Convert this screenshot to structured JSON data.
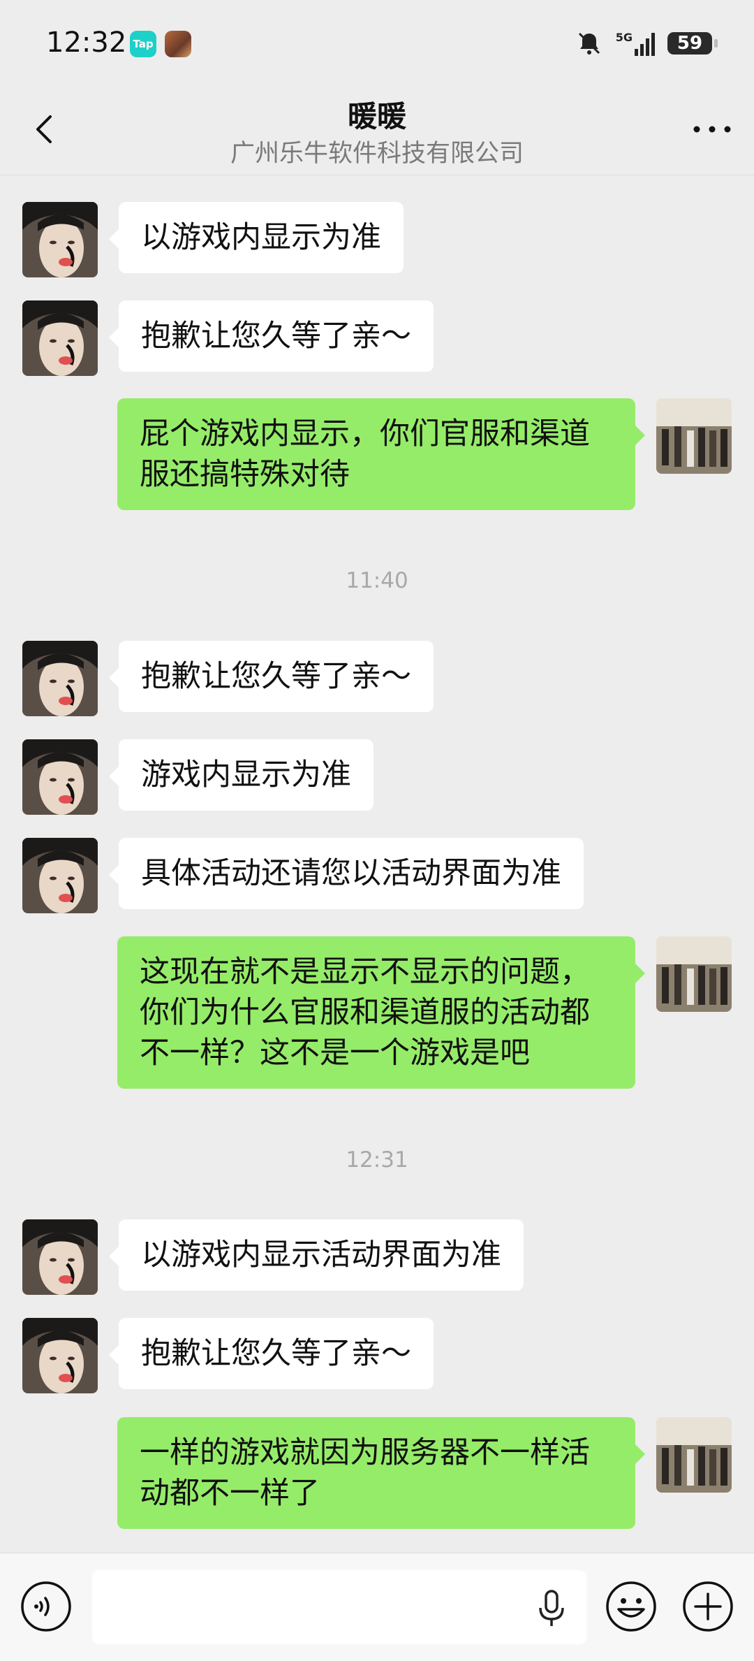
{
  "status_bar": {
    "time": "12:32",
    "tap_app_label": "Tap",
    "network": "5G",
    "battery": "59"
  },
  "header": {
    "title": "暖暖",
    "subtitle": "广州乐牛软件科技有限公司"
  },
  "messages": {
    "m1": "以游戏内显示为准",
    "m2": "抱歉让您久等了亲～",
    "m3": "屁个游戏内显示，你们官服和渠道服还搞特殊对待",
    "t1": "11:40",
    "m4": "抱歉让您久等了亲～",
    "m5": "游戏内显示为准",
    "m6": "具体活动还请您以活动界面为准",
    "m7": "这现在就不是显示不显示的问题，你们为什么官服和渠道服的活动都不一样？这不是一个游戏是吧",
    "t2": "12:31",
    "m8": "以游戏内显示活动界面为准",
    "m9": "抱歉让您久等了亲～",
    "m10": "一样的游戏就因为服务器不一样活动都不一样了"
  },
  "input_bar": {
    "placeholder": ""
  },
  "icons": {
    "back": "chevron-left-icon",
    "more": "more-dots-icon",
    "voice": "voice-icon",
    "mic": "microphone-icon",
    "emoji": "emoji-icon",
    "plus": "plus-icon"
  },
  "colors": {
    "sent_bubble": "#95ec69",
    "received_bubble": "#ffffff",
    "background": "#ededed"
  }
}
